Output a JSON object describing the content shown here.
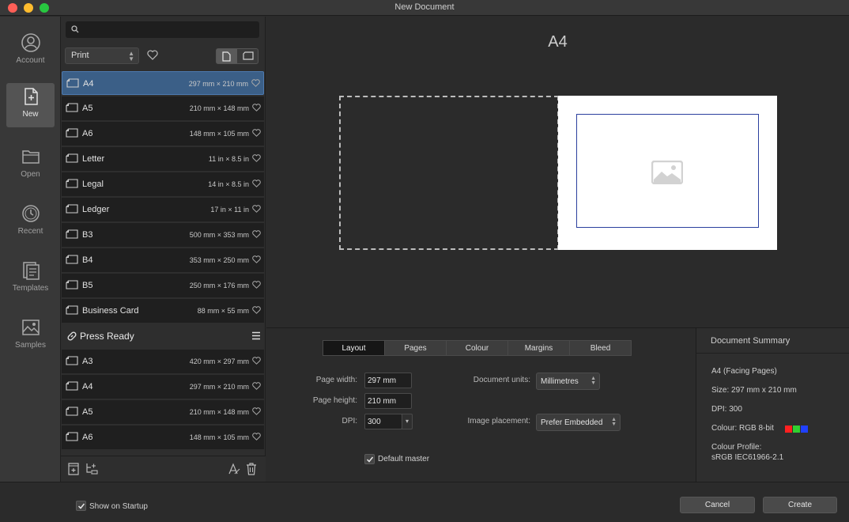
{
  "window": {
    "title": "New Document"
  },
  "nav": [
    {
      "label": "Account",
      "icon": "account-icon"
    },
    {
      "label": "New",
      "icon": "new-document-icon",
      "active": true
    },
    {
      "label": "Open",
      "icon": "folder-icon"
    },
    {
      "label": "Recent",
      "icon": "recent-clock-icon"
    },
    {
      "label": "Templates",
      "icon": "templates-icon"
    },
    {
      "label": "Samples",
      "icon": "samples-image-icon"
    }
  ],
  "search": {
    "placeholder": "",
    "value": ""
  },
  "category": {
    "value": "Print"
  },
  "presets": [
    {
      "name": "A4",
      "size": "297 mm × 210 mm",
      "selected": true
    },
    {
      "name": "A5",
      "size": "210 mm × 148 mm"
    },
    {
      "name": "A6",
      "size": "148 mm × 105 mm"
    },
    {
      "name": "Letter",
      "size": "11 in × 8.5 in"
    },
    {
      "name": "Legal",
      "size": "14 in × 8.5 in"
    },
    {
      "name": "Ledger",
      "size": "17 in × 11 in"
    },
    {
      "name": "B3",
      "size": "500 mm × 353 mm"
    },
    {
      "name": "B4",
      "size": "353 mm × 250 mm"
    },
    {
      "name": "B5",
      "size": "250 mm × 176 mm"
    },
    {
      "name": "Business Card",
      "size": "88 mm × 55 mm"
    }
  ],
  "press_ready": {
    "title": "Press Ready",
    "items": [
      {
        "name": "A3",
        "size": "420 mm × 297 mm"
      },
      {
        "name": "A4",
        "size": "297 mm × 210 mm"
      },
      {
        "name": "A5",
        "size": "210 mm × 148 mm"
      },
      {
        "name": "A6",
        "size": "148 mm × 105 mm"
      }
    ]
  },
  "preview": {
    "title": "A4"
  },
  "tabs": [
    "Layout",
    "Pages",
    "Colour",
    "Margins",
    "Bleed"
  ],
  "layout": {
    "page_width_label": "Page width:",
    "page_width": "297 mm",
    "page_height_label": "Page height:",
    "page_height": "210 mm",
    "dpi_label": "DPI:",
    "dpi": "300",
    "units_label": "Document units:",
    "units": "Millimetres",
    "placement_label": "Image placement:",
    "placement": "Prefer Embedded",
    "default_master": "Default master"
  },
  "summary": {
    "title": "Document Summary",
    "type": "A4 (Facing Pages)",
    "size": "Size: 297 mm x 210 mm",
    "dpi": "DPI:  300",
    "colour": "Colour: RGB 8-bit",
    "profile_label": "Colour Profile:",
    "profile": "sRGB IEC61966-2.1",
    "swatches": [
      "#ff2020",
      "#30d030",
      "#2040ff"
    ]
  },
  "footer": {
    "show_on_startup": "Show on Startup",
    "cancel": "Cancel",
    "create": "Create"
  },
  "colors": {
    "accent": "#3b5f87",
    "margin_guide": "#2b3f9e"
  }
}
